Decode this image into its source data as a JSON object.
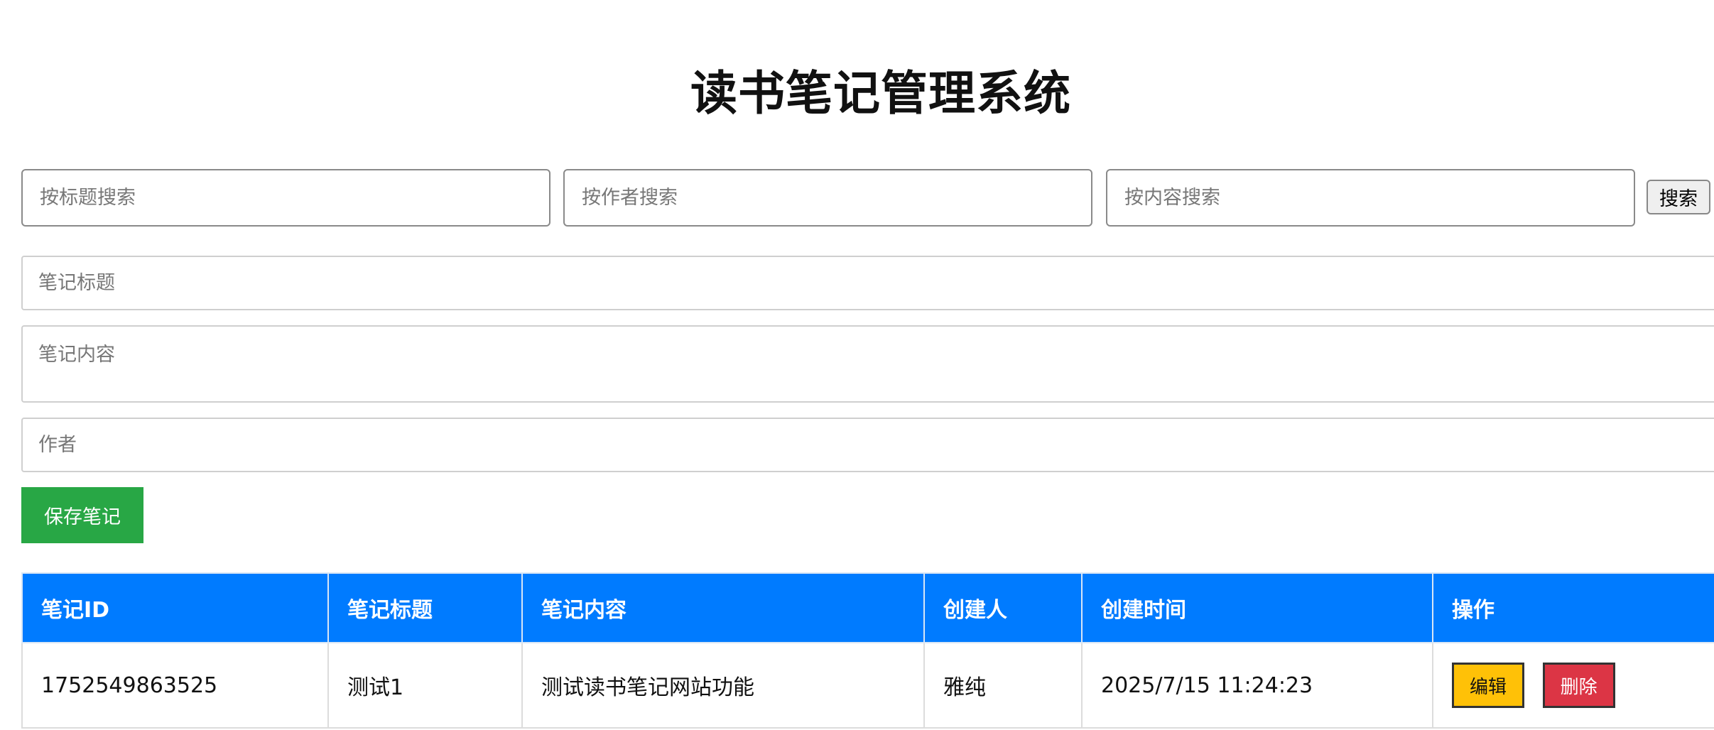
{
  "title": "读书笔记管理系统",
  "search": {
    "title_placeholder": "按标题搜索",
    "author_placeholder": "按作者搜索",
    "content_placeholder": "按内容搜索",
    "button_label": "搜索"
  },
  "form": {
    "title_placeholder": "笔记标题",
    "content_placeholder": "笔记内容",
    "author_placeholder": "作者",
    "save_label": "保存笔记"
  },
  "table": {
    "headers": [
      "笔记ID",
      "笔记标题",
      "笔记内容",
      "创建人",
      "创建时间",
      "操作"
    ],
    "rows": [
      {
        "id": "1752549863525",
        "title": "测试1",
        "content": "测试读书笔记网站功能",
        "creator": "雅纯",
        "created_at": "2025/7/15 11:24:23",
        "edit_label": "编辑",
        "delete_label": "删除"
      }
    ]
  },
  "colors": {
    "header_bg": "#007bff",
    "save_button": "#28a745",
    "edit_button": "#ffc107",
    "delete_button": "#dc3545"
  }
}
